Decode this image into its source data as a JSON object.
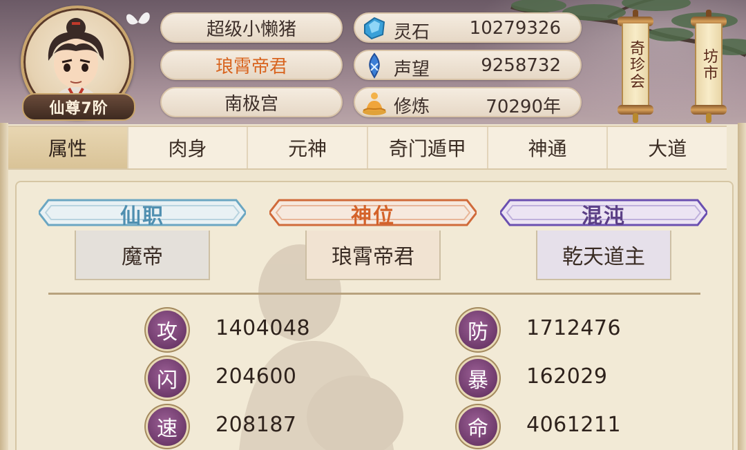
{
  "player": {
    "name": "超级小懒猪",
    "title": "琅霄帝君",
    "sect": "南极宫",
    "rank": "仙尊7阶"
  },
  "resources": [
    {
      "icon": "spirit-stone-icon",
      "label": "灵石",
      "value": "10279326"
    },
    {
      "icon": "prestige-icon",
      "label": "声望",
      "value": "9258732"
    },
    {
      "icon": "meditation-icon",
      "label": "修炼",
      "value": "70290年"
    }
  ],
  "shortcuts": {
    "treasure_fair": "奇珍会",
    "market": "坊市"
  },
  "tabs": [
    {
      "label": "属性",
      "active": true
    },
    {
      "label": "肉身",
      "active": false
    },
    {
      "label": "元神",
      "active": false
    },
    {
      "label": "奇门遁甲",
      "active": false
    },
    {
      "label": "神通",
      "active": false
    },
    {
      "label": "大道",
      "active": false
    }
  ],
  "titles": [
    {
      "heading": "仙职",
      "value": "魔帝",
      "color": "#4f8fb0"
    },
    {
      "heading": "神位",
      "value": "琅霄帝君",
      "color": "#d4632a"
    },
    {
      "heading": "混沌",
      "value": "乾天道主",
      "color": "#5b3f86"
    }
  ],
  "stats": {
    "left": [
      {
        "label": "攻",
        "value": "1404048"
      },
      {
        "label": "闪",
        "value": "204600"
      },
      {
        "label": "速",
        "value": "208187"
      }
    ],
    "right": [
      {
        "label": "防",
        "value": "1712476"
      },
      {
        "label": "暴",
        "value": "162029"
      },
      {
        "label": "命",
        "value": "4061211"
      }
    ]
  }
}
